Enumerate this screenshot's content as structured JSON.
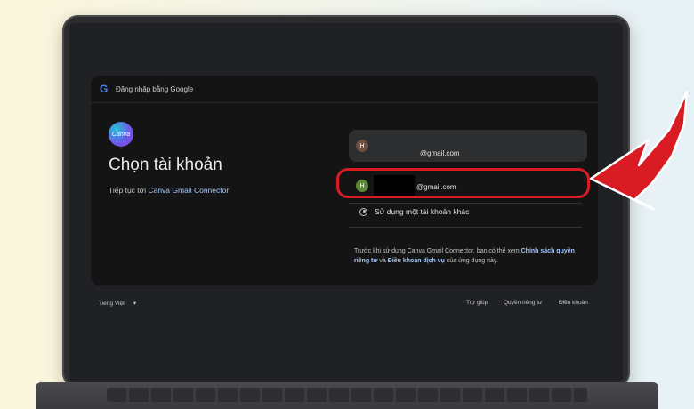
{
  "header": {
    "text": "Đăng nhập bằng Google"
  },
  "brand": {
    "logo_text": "Canva"
  },
  "main": {
    "title": "Chọn tài khoản",
    "subtitle_prefix": "Tiếp tục tới ",
    "subtitle_app": "Canva Gmail Connector"
  },
  "accounts": [
    {
      "avatar": "H",
      "email": "@gmail.com"
    },
    {
      "avatar": "H",
      "email": "@gmail.com"
    }
  ],
  "other_account": {
    "label": "Sử dụng một tài khoản khác"
  },
  "notice": {
    "p1": "Trước khi sử dụng Canva Gmail Connector, bạn có thể xem ",
    "link1": "Chính sách quyền riêng tư",
    "p2": " và ",
    "link2": "Điều khoản dịch vụ",
    "p3": " của ứng dụng này."
  },
  "footer": {
    "language": "Tiếng Việt",
    "help": "Trợ giúp",
    "privacy": "Quyền riêng tư",
    "terms": "Điều khoản"
  },
  "colors": {
    "highlight": "#d91c24",
    "link": "#a8c7fa",
    "panel": "#141414"
  }
}
